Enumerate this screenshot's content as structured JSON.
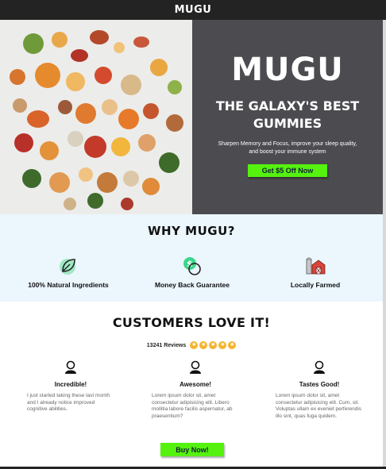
{
  "topbar": {
    "brand": "MUGU"
  },
  "hero": {
    "title": "MUGU",
    "subtitle": "THE GALAXY'S BEST GUMMIES",
    "description": "Sharpen Memory and Focus, improve your sleep quality, and boost your immune system",
    "cta": "Get $5 Off Now"
  },
  "why": {
    "title": "WHY MUGU?",
    "features": [
      {
        "label": "100% Natural Ingredients",
        "icon": "leaf-icon"
      },
      {
        "label": "Money Back Guarantee",
        "icon": "money-icon"
      },
      {
        "label": "Locally Farmed",
        "icon": "barn-icon"
      }
    ]
  },
  "customers": {
    "title": "CUSTOMERS LOVE IT!",
    "review_count": "13241 Reviews",
    "stars": 5,
    "reviews": [
      {
        "title": "Incredible!",
        "body": "I just started taking these last month and I already notice improved cognitive abilities."
      },
      {
        "title": "Awesome!",
        "body": "Lorem ipsum dolor sit, amet consectetur adipisicing elit. Libero mollitia labore facilis aspernatur, ab praesentium?"
      },
      {
        "title": "Tastes Good!",
        "body": "Lorem ipsum dolor sit, amet consectetur adipisicing elit. Cum, sit. Voluptas ullam ex eveniet perferendis illo sint, quas fuga quidem."
      }
    ],
    "cta": "Buy Now!"
  },
  "colors": {
    "accent": "#55f20f",
    "hero_bg": "#4c4c50",
    "why_bg": "#ebf6fd",
    "star": "#f3b430"
  }
}
